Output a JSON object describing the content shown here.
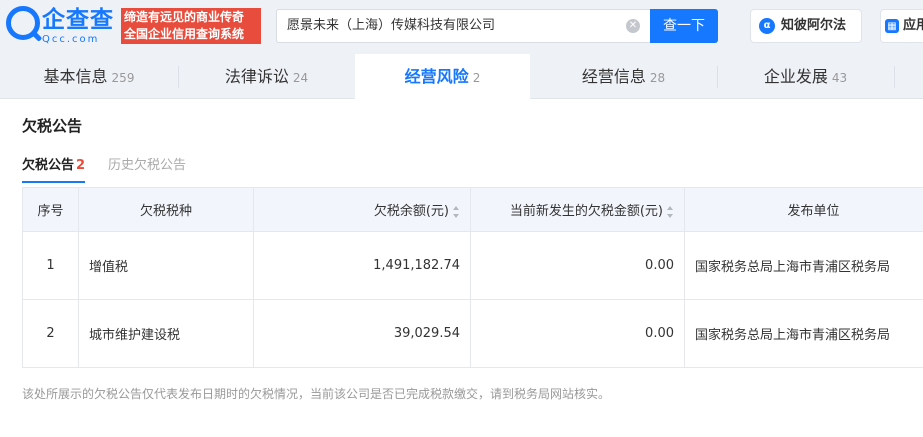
{
  "header": {
    "logo_cn": "企查查",
    "logo_en": "Qcc.com",
    "slogan_line1": "缔造有远见的商业传奇",
    "slogan_line2": "全国企业信用查询系统",
    "search_value": "愿景未来（上海）传媒科技有限公司",
    "search_button": "查一下",
    "zhibi_label": "知彼阿尔法",
    "ying_label": "应用"
  },
  "tabs": [
    {
      "label": "基本信息",
      "count": "259"
    },
    {
      "label": "法律诉讼",
      "count": "24"
    },
    {
      "label": "经营风险",
      "count": "2"
    },
    {
      "label": "经营信息",
      "count": "28"
    },
    {
      "label": "企业发展",
      "count": "43"
    }
  ],
  "section": {
    "title": "欠税公告",
    "subtab_active": "欠税公告",
    "subtab_active_count": "2",
    "subtab_history": "历史欠税公告"
  },
  "table": {
    "headers": {
      "no": "序号",
      "type": "欠税税种",
      "balance": "欠税余额(元)",
      "new_amount": "当前新发生的欠税金额(元)",
      "unit": "发布单位"
    },
    "rows": [
      {
        "no": "1",
        "type": "增值税",
        "balance": "1,491,182.74",
        "new_amount": "0.00",
        "unit": "国家税务总局上海市青浦区税务局"
      },
      {
        "no": "2",
        "type": "城市维护建设税",
        "balance": "39,029.54",
        "new_amount": "0.00",
        "unit": "国家税务总局上海市青浦区税务局"
      }
    ]
  },
  "footnote": "该处所展示的欠税公告仅代表发布日期时的欠税情况，当前该公司是否已完成税款缴交，请到税务局网站核实。",
  "colors": {
    "brand": "#1677ff",
    "slogan_bg": "#e74c3c",
    "badge": "#e74c3c"
  }
}
